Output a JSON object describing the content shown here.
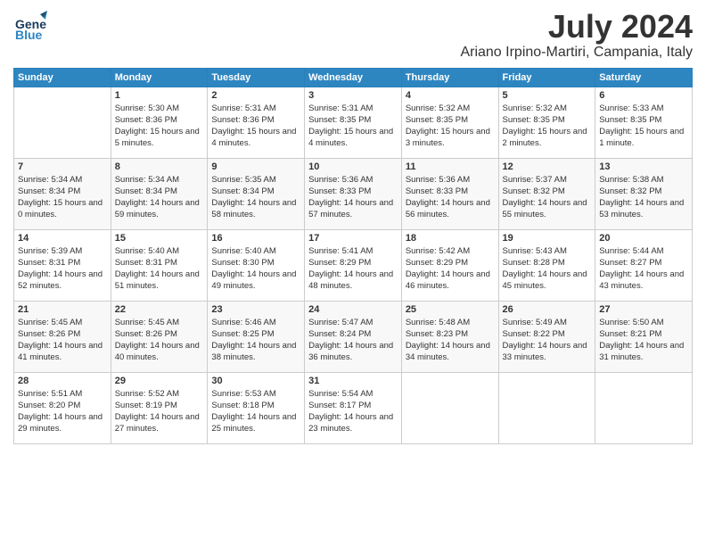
{
  "header": {
    "logo_line1": "General",
    "logo_line2": "Blue",
    "month": "July 2024",
    "location": "Ariano Irpino-Martiri, Campania, Italy"
  },
  "days_of_week": [
    "Sunday",
    "Monday",
    "Tuesday",
    "Wednesday",
    "Thursday",
    "Friday",
    "Saturday"
  ],
  "weeks": [
    [
      {
        "day": "",
        "sunrise": "",
        "sunset": "",
        "daylight": ""
      },
      {
        "day": "1",
        "sunrise": "Sunrise: 5:30 AM",
        "sunset": "Sunset: 8:36 PM",
        "daylight": "Daylight: 15 hours and 5 minutes."
      },
      {
        "day": "2",
        "sunrise": "Sunrise: 5:31 AM",
        "sunset": "Sunset: 8:36 PM",
        "daylight": "Daylight: 15 hours and 4 minutes."
      },
      {
        "day": "3",
        "sunrise": "Sunrise: 5:31 AM",
        "sunset": "Sunset: 8:35 PM",
        "daylight": "Daylight: 15 hours and 4 minutes."
      },
      {
        "day": "4",
        "sunrise": "Sunrise: 5:32 AM",
        "sunset": "Sunset: 8:35 PM",
        "daylight": "Daylight: 15 hours and 3 minutes."
      },
      {
        "day": "5",
        "sunrise": "Sunrise: 5:32 AM",
        "sunset": "Sunset: 8:35 PM",
        "daylight": "Daylight: 15 hours and 2 minutes."
      },
      {
        "day": "6",
        "sunrise": "Sunrise: 5:33 AM",
        "sunset": "Sunset: 8:35 PM",
        "daylight": "Daylight: 15 hours and 1 minute."
      }
    ],
    [
      {
        "day": "7",
        "sunrise": "Sunrise: 5:34 AM",
        "sunset": "Sunset: 8:34 PM",
        "daylight": "Daylight: 15 hours and 0 minutes."
      },
      {
        "day": "8",
        "sunrise": "Sunrise: 5:34 AM",
        "sunset": "Sunset: 8:34 PM",
        "daylight": "Daylight: 14 hours and 59 minutes."
      },
      {
        "day": "9",
        "sunrise": "Sunrise: 5:35 AM",
        "sunset": "Sunset: 8:34 PM",
        "daylight": "Daylight: 14 hours and 58 minutes."
      },
      {
        "day": "10",
        "sunrise": "Sunrise: 5:36 AM",
        "sunset": "Sunset: 8:33 PM",
        "daylight": "Daylight: 14 hours and 57 minutes."
      },
      {
        "day": "11",
        "sunrise": "Sunrise: 5:36 AM",
        "sunset": "Sunset: 8:33 PM",
        "daylight": "Daylight: 14 hours and 56 minutes."
      },
      {
        "day": "12",
        "sunrise": "Sunrise: 5:37 AM",
        "sunset": "Sunset: 8:32 PM",
        "daylight": "Daylight: 14 hours and 55 minutes."
      },
      {
        "day": "13",
        "sunrise": "Sunrise: 5:38 AM",
        "sunset": "Sunset: 8:32 PM",
        "daylight": "Daylight: 14 hours and 53 minutes."
      }
    ],
    [
      {
        "day": "14",
        "sunrise": "Sunrise: 5:39 AM",
        "sunset": "Sunset: 8:31 PM",
        "daylight": "Daylight: 14 hours and 52 minutes."
      },
      {
        "day": "15",
        "sunrise": "Sunrise: 5:40 AM",
        "sunset": "Sunset: 8:31 PM",
        "daylight": "Daylight: 14 hours and 51 minutes."
      },
      {
        "day": "16",
        "sunrise": "Sunrise: 5:40 AM",
        "sunset": "Sunset: 8:30 PM",
        "daylight": "Daylight: 14 hours and 49 minutes."
      },
      {
        "day": "17",
        "sunrise": "Sunrise: 5:41 AM",
        "sunset": "Sunset: 8:29 PM",
        "daylight": "Daylight: 14 hours and 48 minutes."
      },
      {
        "day": "18",
        "sunrise": "Sunrise: 5:42 AM",
        "sunset": "Sunset: 8:29 PM",
        "daylight": "Daylight: 14 hours and 46 minutes."
      },
      {
        "day": "19",
        "sunrise": "Sunrise: 5:43 AM",
        "sunset": "Sunset: 8:28 PM",
        "daylight": "Daylight: 14 hours and 45 minutes."
      },
      {
        "day": "20",
        "sunrise": "Sunrise: 5:44 AM",
        "sunset": "Sunset: 8:27 PM",
        "daylight": "Daylight: 14 hours and 43 minutes."
      }
    ],
    [
      {
        "day": "21",
        "sunrise": "Sunrise: 5:45 AM",
        "sunset": "Sunset: 8:26 PM",
        "daylight": "Daylight: 14 hours and 41 minutes."
      },
      {
        "day": "22",
        "sunrise": "Sunrise: 5:45 AM",
        "sunset": "Sunset: 8:26 PM",
        "daylight": "Daylight: 14 hours and 40 minutes."
      },
      {
        "day": "23",
        "sunrise": "Sunrise: 5:46 AM",
        "sunset": "Sunset: 8:25 PM",
        "daylight": "Daylight: 14 hours and 38 minutes."
      },
      {
        "day": "24",
        "sunrise": "Sunrise: 5:47 AM",
        "sunset": "Sunset: 8:24 PM",
        "daylight": "Daylight: 14 hours and 36 minutes."
      },
      {
        "day": "25",
        "sunrise": "Sunrise: 5:48 AM",
        "sunset": "Sunset: 8:23 PM",
        "daylight": "Daylight: 14 hours and 34 minutes."
      },
      {
        "day": "26",
        "sunrise": "Sunrise: 5:49 AM",
        "sunset": "Sunset: 8:22 PM",
        "daylight": "Daylight: 14 hours and 33 minutes."
      },
      {
        "day": "27",
        "sunrise": "Sunrise: 5:50 AM",
        "sunset": "Sunset: 8:21 PM",
        "daylight": "Daylight: 14 hours and 31 minutes."
      }
    ],
    [
      {
        "day": "28",
        "sunrise": "Sunrise: 5:51 AM",
        "sunset": "Sunset: 8:20 PM",
        "daylight": "Daylight: 14 hours and 29 minutes."
      },
      {
        "day": "29",
        "sunrise": "Sunrise: 5:52 AM",
        "sunset": "Sunset: 8:19 PM",
        "daylight": "Daylight: 14 hours and 27 minutes."
      },
      {
        "day": "30",
        "sunrise": "Sunrise: 5:53 AM",
        "sunset": "Sunset: 8:18 PM",
        "daylight": "Daylight: 14 hours and 25 minutes."
      },
      {
        "day": "31",
        "sunrise": "Sunrise: 5:54 AM",
        "sunset": "Sunset: 8:17 PM",
        "daylight": "Daylight: 14 hours and 23 minutes."
      },
      {
        "day": "",
        "sunrise": "",
        "sunset": "",
        "daylight": ""
      },
      {
        "day": "",
        "sunrise": "",
        "sunset": "",
        "daylight": ""
      },
      {
        "day": "",
        "sunrise": "",
        "sunset": "",
        "daylight": ""
      }
    ]
  ]
}
